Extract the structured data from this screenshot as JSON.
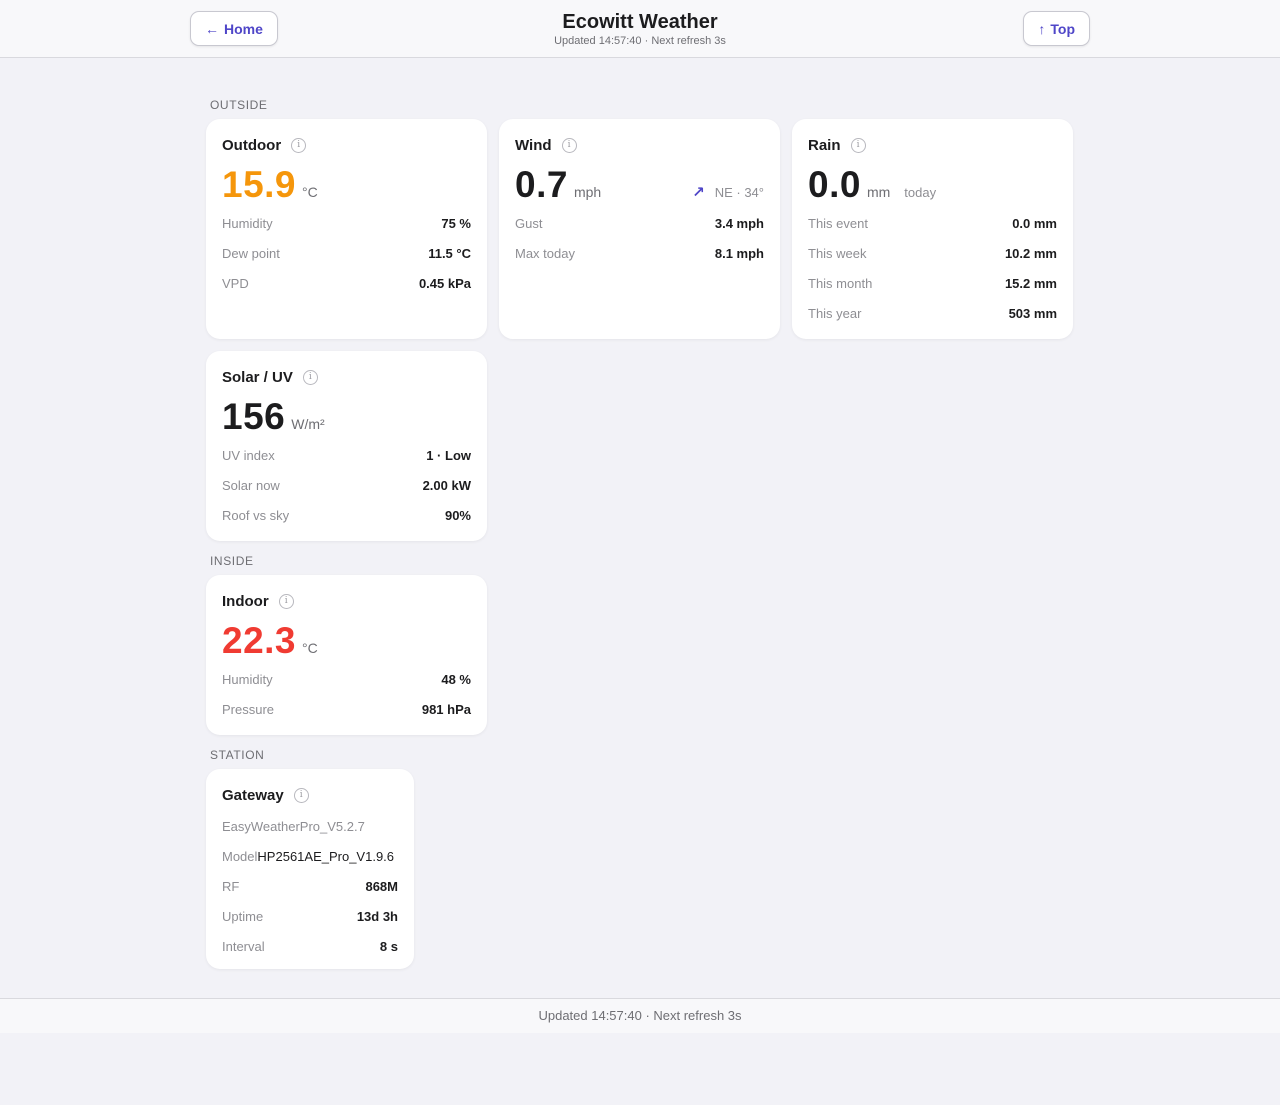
{
  "header": {
    "home_label": "Home",
    "top_label": "Top",
    "title": "Ecowitt Weather",
    "subtitle": "Updated 14:57:40 · Next refresh 3s"
  },
  "sections": {
    "outside": "OUTSIDE",
    "inside": "INSIDE",
    "station": "STATION"
  },
  "outdoor": {
    "title": "Outdoor",
    "value": "15.9",
    "unit": "°C",
    "rows": [
      {
        "label": "Humidity",
        "value": "75 %"
      },
      {
        "label": "Dew point",
        "value": "11.5 °C"
      },
      {
        "label": "VPD",
        "value": "0.45 kPa"
      }
    ]
  },
  "wind": {
    "title": "Wind",
    "value": "0.7",
    "unit": "mph",
    "direction": "NE · 34°",
    "rows": [
      {
        "label": "Gust",
        "value": "3.4 mph"
      },
      {
        "label": "Max today",
        "value": "8.1 mph"
      }
    ]
  },
  "rain": {
    "title": "Rain",
    "value": "0.0",
    "unit": "mm",
    "extra": "today",
    "rows": [
      {
        "label": "This event",
        "value": "0.0 mm"
      },
      {
        "label": "This week",
        "value": "10.2 mm"
      },
      {
        "label": "This month",
        "value": "15.2 mm"
      },
      {
        "label": "This year",
        "value": "503 mm"
      }
    ]
  },
  "solar": {
    "title": "Solar / UV",
    "value": "156",
    "unit": "W/m²",
    "rows": [
      {
        "label": "UV index",
        "value": "1 · Low"
      },
      {
        "label": "Solar now",
        "value": "2.00 kW"
      },
      {
        "label": "Roof vs sky",
        "value": "90%"
      }
    ]
  },
  "indoor": {
    "title": "Indoor",
    "value": "22.3",
    "unit": "°C",
    "rows": [
      {
        "label": "Humidity",
        "value": "48 %"
      },
      {
        "label": "Pressure",
        "value": "981 hPa"
      }
    ]
  },
  "gateway": {
    "title": "Gateway",
    "firmware": "EasyWeatherPro_V5.2.7",
    "model_label": "Model",
    "model_value": "HP2561AE_Pro_V1.9.6",
    "rows": [
      {
        "label": "RF",
        "value": "868M"
      },
      {
        "label": "Uptime",
        "value": "13d 3h"
      },
      {
        "label": "Interval",
        "value": "8 s"
      }
    ]
  },
  "footer": {
    "text": "Updated 14:57:40 · Next refresh 3s"
  },
  "colors": {
    "accent": "#4f46c8",
    "outdoor_temp": "#f5960b",
    "indoor_temp": "#f03b32"
  },
  "icons": {
    "home_arrow": "arrow-left-icon",
    "top_arrow": "arrow-up-icon",
    "info": "info-icon",
    "wind_direction": "arrow-up-right-icon"
  }
}
